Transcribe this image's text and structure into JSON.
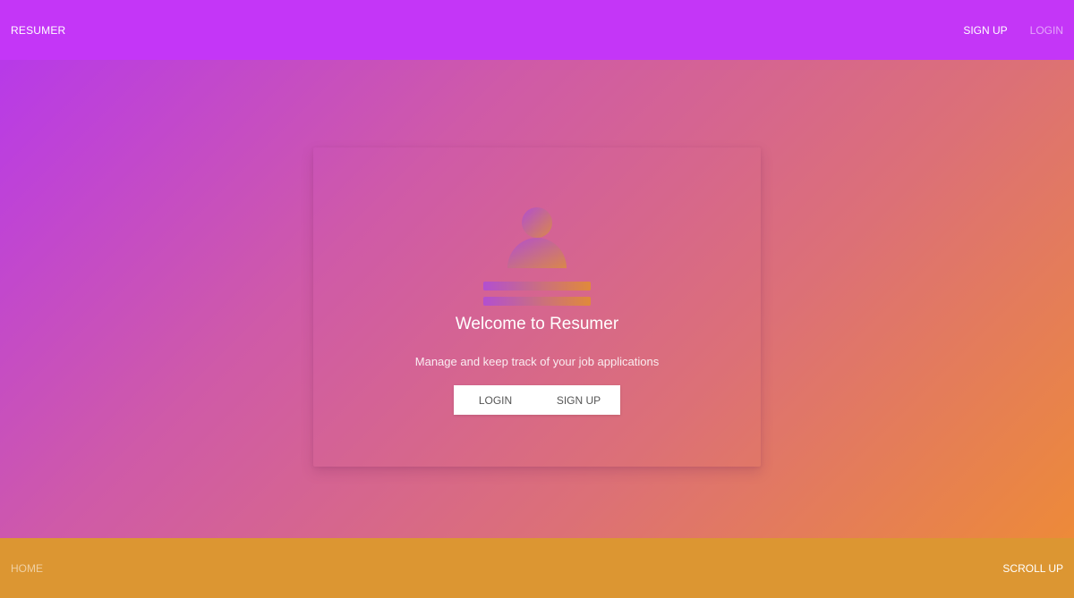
{
  "header": {
    "brand": "RESUMER",
    "nav": {
      "signup_label": "SIGN UP",
      "login_label": "LOGIN"
    }
  },
  "hero": {
    "title": "Welcome to Resumer",
    "subtitle": "Manage and keep track of your job applications",
    "login_label": "LOGIN",
    "signup_label": "SIGN UP",
    "icon": "resume-user-icon"
  },
  "footer": {
    "home_label": "HOME",
    "scroll_up_label": "SCROLL UP"
  },
  "colors": {
    "header_bg": "#c436f7",
    "footer_bg": "#dc9632",
    "gradient_start": "#b536f0",
    "gradient_end": "#ef8d32",
    "button_bg": "#ffffff"
  }
}
